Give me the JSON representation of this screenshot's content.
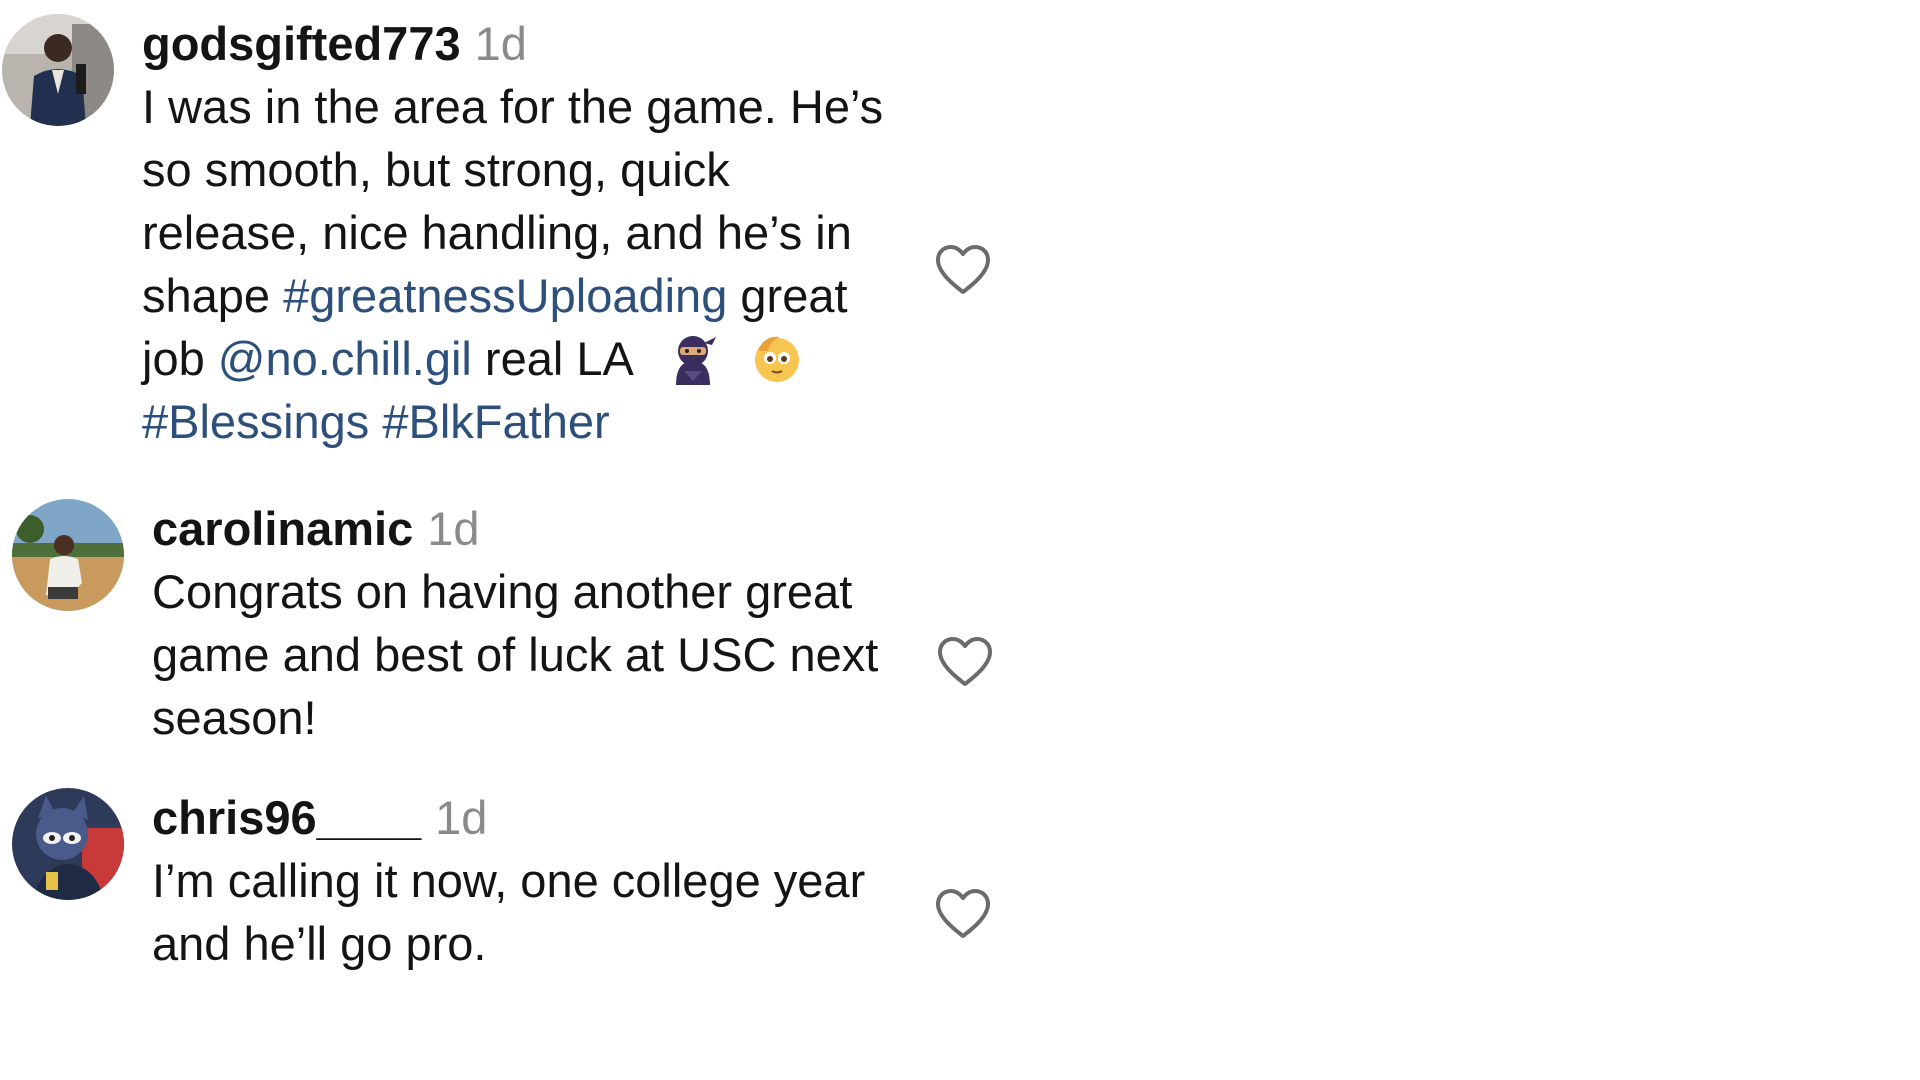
{
  "comments": [
    {
      "username": "godsgifted773",
      "time": "1d",
      "text_line1": "I was in the area for the game. He’s",
      "text_line2": "so smooth, but strong, quick",
      "text_line3": "release, nice handling, and he’s in",
      "text_pre_tag": "shape ",
      "hashtag_greatness": "#greatnessUploading",
      "text_post_tag": " great",
      "text_pre_mention": "job ",
      "mention": "@no.chill.gil",
      "text_post_mention": " real LA",
      "emoji_1": "ninja-emoji",
      "emoji_2": "blushing-face-emoji",
      "hashtag_blessings": "#Blessings",
      "hashtag_blkfather": "#BlkFather",
      "like_icon": "heart-outline-icon"
    },
    {
      "username": "carolinamic",
      "time": "1d",
      "text_line1": "Congrats on having another great",
      "text_line2": "game and best of luck at USC next",
      "text_line3": "season!",
      "like_icon": "heart-outline-icon"
    },
    {
      "username": "chris96____",
      "time": "1d",
      "text_line1": "I’m calling it now, one college year",
      "text_line2": "and he’ll go pro.",
      "like_icon": "heart-outline-icon"
    }
  ],
  "colors": {
    "link": "#2c4f7c",
    "text": "#141414",
    "timestamp": "#8a8a8a",
    "background": "#ffffff"
  }
}
